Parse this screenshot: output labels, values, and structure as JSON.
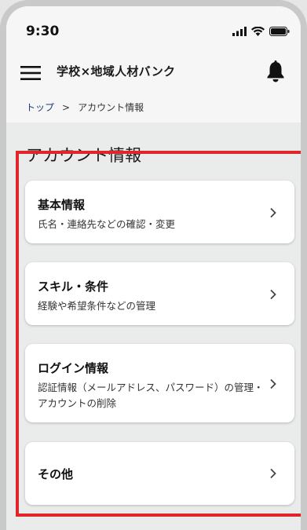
{
  "status_bar": {
    "time": "9:30",
    "icons": [
      "signal-icon",
      "wifi-icon",
      "battery-icon"
    ]
  },
  "app_bar": {
    "title": "学校×地域人材バンク",
    "menu_icon": "hamburger-menu-icon",
    "notification_icon": "bell-icon"
  },
  "breadcrumb": {
    "home": "トップ",
    "separator": ">",
    "current": "アカウント情報"
  },
  "page": {
    "title": "アカウント情報"
  },
  "cards": [
    {
      "title": "基本情報",
      "description": "氏名・連絡先などの確認・変更"
    },
    {
      "title": "スキル・条件",
      "description": "経験や希望条件などの管理"
    },
    {
      "title": "ログイン情報",
      "description": "認証情報（メールアドレス、パスワード）の管理・アカウントの削除"
    },
    {
      "title": "その他",
      "description": ""
    }
  ],
  "colors": {
    "highlight": "#e0262b",
    "breadcrumb_link": "#1f3a78"
  }
}
